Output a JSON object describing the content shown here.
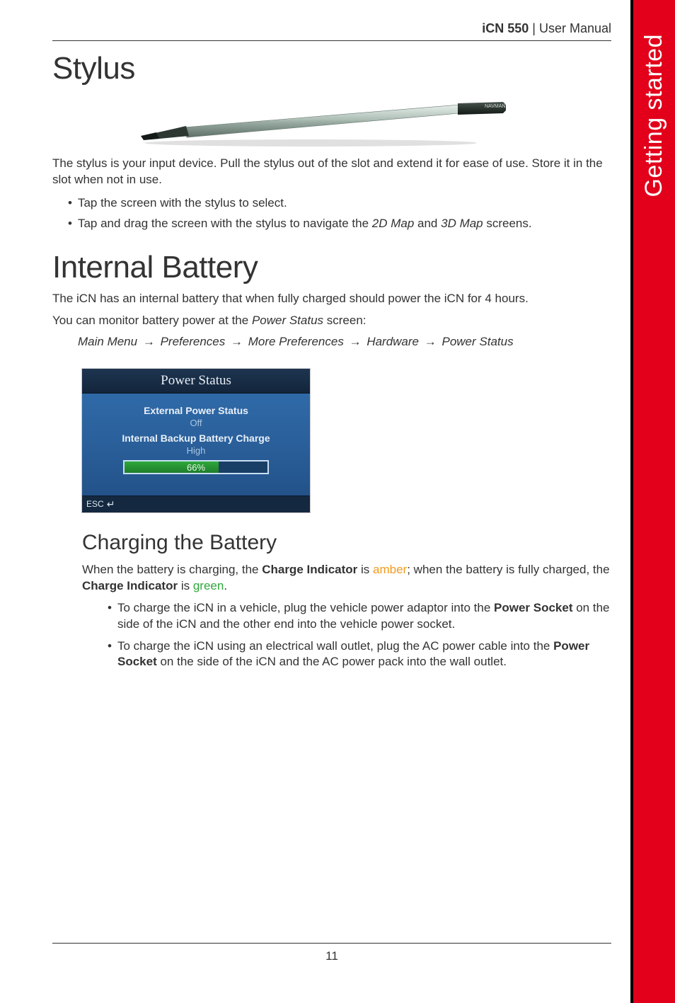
{
  "header": {
    "product": "iCN 550",
    "separator": " | ",
    "doc": "User Manual"
  },
  "side_tab": "Getting started",
  "stylus": {
    "heading": "Stylus",
    "intro": "The stylus is your input device. Pull the stylus out of the slot and extend it for ease of use. Store it in the slot when not in use.",
    "bullets": {
      "b1": "Tap the screen with the stylus to select.",
      "b2_pre": "Tap and drag the screen with the stylus to navigate the ",
      "b2_i1": "2D Map",
      "b2_mid": " and ",
      "b2_i2": "3D Map",
      "b2_post": " screens."
    }
  },
  "battery": {
    "heading": "Internal Battery",
    "p1": "The iCN has an internal battery that when fully charged should power the iCN for 4 hours.",
    "p2_pre": "You can monitor battery power at the ",
    "p2_i": "Power Status",
    "p2_post": " screen:",
    "breadcrumb": {
      "a": "Main Menu",
      "b": "Preferences",
      "c": "More Preferences",
      "d": "Hardware",
      "e": "Power Status"
    }
  },
  "power_status_screen": {
    "title": "Power Status",
    "ext_label": "External Power Status",
    "ext_val": "Off",
    "int_label": "Internal Backup Battery Charge",
    "int_val": "High",
    "percent": "66%",
    "percent_num": 66,
    "esc": "ESC"
  },
  "charging": {
    "heading": "Charging the Battery",
    "p_parts": {
      "a": "When the battery is charging, the ",
      "b_bold": "Charge Indicator",
      "c": " is ",
      "d_amber": "amber",
      "e": "; when the battery is fully charged, the ",
      "f_bold": "Charge Indicator",
      "g": " is ",
      "h_green": "green",
      "i": "."
    },
    "bullets": {
      "b1_a": "To charge the iCN in a vehicle, plug the vehicle power adaptor into the ",
      "b1_b_bold": "Power Socket",
      "b1_c": " on the side of the iCN and the other end into the vehicle power socket.",
      "b2_a": "To charge the iCN using an electrical wall outlet, plug the AC power cable into the ",
      "b2_b_bold": "Power Socket",
      "b2_c": " on the side of the iCN and the AC power pack into the wall outlet."
    }
  },
  "page_number": "11"
}
